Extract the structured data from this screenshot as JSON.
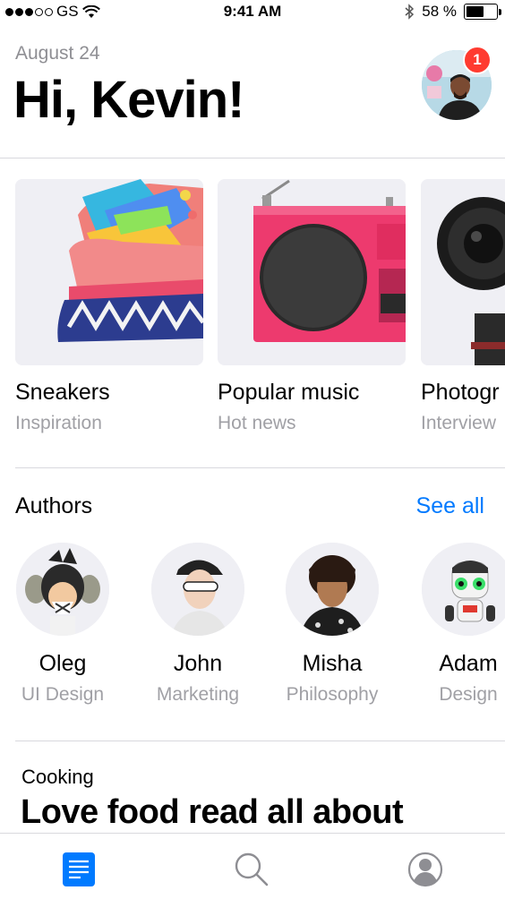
{
  "status_bar": {
    "carrier": "GS",
    "time": "9:41 AM",
    "battery": "58 %",
    "battery_level": 0.58
  },
  "header": {
    "date": "August 24",
    "greeting": "Hi, Kevin!",
    "notification_count": "1"
  },
  "cards": [
    {
      "title": "Sneakers",
      "subtitle": "Inspiration",
      "icon": "sneaker-image"
    },
    {
      "title": "Popular music",
      "subtitle": "Hot news",
      "icon": "radio-image"
    },
    {
      "title": "Photogr",
      "subtitle": "Interview",
      "icon": "camera-image"
    }
  ],
  "authors_section": {
    "title": "Authors",
    "see_all": "See all"
  },
  "authors": [
    {
      "name": "Oleg",
      "role": "UI Design"
    },
    {
      "name": "John",
      "role": "Marketing"
    },
    {
      "name": "Misha",
      "role": "Philosophy"
    },
    {
      "name": "Adam",
      "role": "Design"
    }
  ],
  "article": {
    "category": "Cooking",
    "title": "Love food read all about"
  },
  "tab_bar": {
    "items": [
      {
        "icon": "document-icon",
        "active": true
      },
      {
        "icon": "search-icon",
        "active": false
      },
      {
        "icon": "profile-icon",
        "active": false
      }
    ]
  },
  "colors": {
    "accent": "#007aff",
    "badge": "#ff3b30",
    "secondary_text": "#a0a0a5",
    "card_background": "#efeff4"
  }
}
